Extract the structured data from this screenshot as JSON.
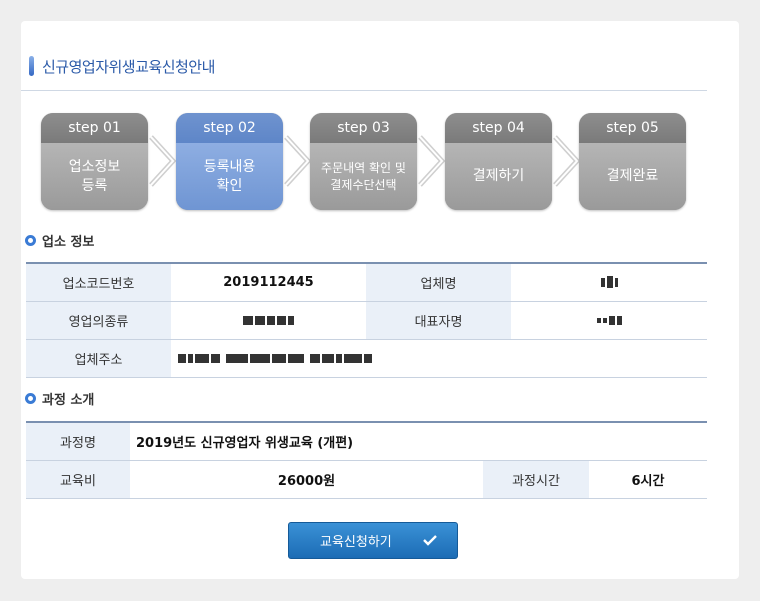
{
  "page_title": "신규영업자위생교육신청안내",
  "steps": [
    {
      "num": "step 01",
      "line1": "업소정보",
      "line2": "등록",
      "active": false
    },
    {
      "num": "step 02",
      "line1": "등록내용",
      "line2": "확인",
      "active": true
    },
    {
      "num": "step 03",
      "line1": "주문내역 확인 및",
      "line2": "결제수단선택",
      "active": false
    },
    {
      "num": "step 04",
      "line1": "결제하기",
      "line2": "",
      "active": false
    },
    {
      "num": "step 05",
      "line1": "결제완료",
      "line2": "",
      "active": false
    }
  ],
  "business_info": {
    "heading": "업소 정보",
    "code_label": "업소코드번호",
    "code_value": "2019112445",
    "name_label": "업체명",
    "type_label": "영업의종류",
    "rep_label": "대표자명",
    "address_label": "업체주소"
  },
  "course_intro": {
    "heading": "과정 소개",
    "course_label": "과정명",
    "course_value": "2019년도 신규영업자 위생교육 (개편)",
    "fee_label": "교육비",
    "fee_value": "26000원",
    "time_label": "과정시간",
    "time_value": "6시간"
  },
  "submit_label": "교육신청하기",
  "colors": {
    "accent": "#2b5aa8",
    "button": "#1c6cb5",
    "step_active": "#6f95d3",
    "step_inactive": "#8a8a8a"
  }
}
